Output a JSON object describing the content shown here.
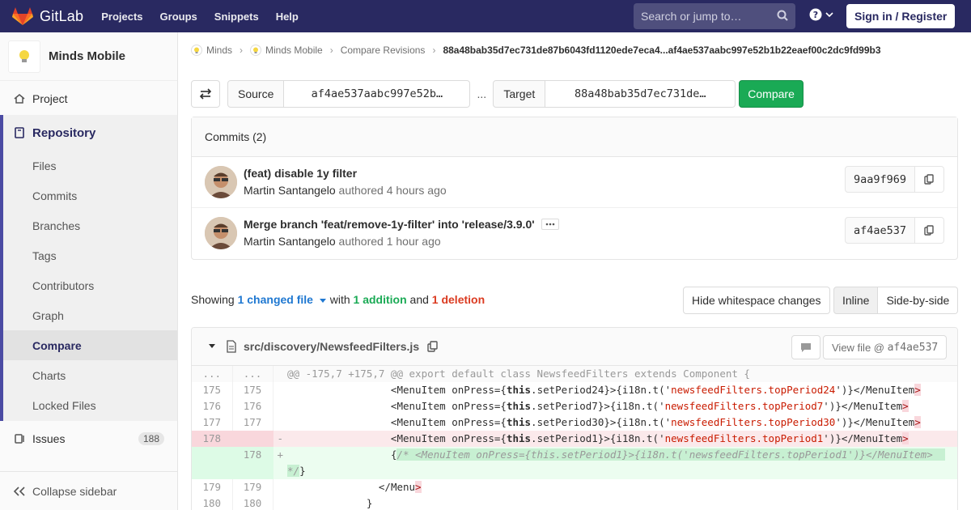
{
  "nav": {
    "brand": "GitLab",
    "links": [
      "Projects",
      "Groups",
      "Snippets",
      "Help"
    ],
    "search_placeholder": "Search or jump to…",
    "signin": "Sign in / Register"
  },
  "sidebar": {
    "project_name": "Minds Mobile",
    "project": "Project",
    "repository": "Repository",
    "repo_items": [
      "Files",
      "Commits",
      "Branches",
      "Tags",
      "Contributors",
      "Graph",
      "Compare",
      "Charts",
      "Locked Files"
    ],
    "issues": "Issues",
    "issues_count": "188",
    "collapse": "Collapse sidebar"
  },
  "breadcrumb": {
    "group": "Minds",
    "project": "Minds Mobile",
    "page": "Compare Revisions",
    "current": "88a48bab35d7ec731de87b6043fd1120ede7eca4...af4ae537aabc997e52b1b22eaef00c2dc9fd99b3"
  },
  "compare": {
    "source_label": "Source",
    "source_value": "af4ae537aabc997e52b…",
    "dots": "...",
    "target_label": "Target",
    "target_value": "88a48bab35d7ec731de…",
    "button": "Compare"
  },
  "commits": {
    "header": "Commits (2)",
    "items": [
      {
        "title": "(feat) disable 1y filter",
        "author": "Martin Santangelo",
        "authored": "authored",
        "time": "4 hours ago",
        "sha": "9aa9f969"
      },
      {
        "title": "Merge branch 'feat/remove-1y-filter' into 'release/3.9.0'",
        "author": "Martin Santangelo",
        "authored": "authored",
        "time": "1 hour ago",
        "sha": "af4ae537"
      }
    ]
  },
  "summary": {
    "showing": "Showing",
    "changed": "1 changed file",
    "with": "with",
    "additions": "1 addition",
    "and": "and",
    "deletions": "1 deletion",
    "hide_ws": "Hide whitespace changes",
    "inline": "Inline",
    "side_by_side": "Side-by-side"
  },
  "file": {
    "path": "src/discovery/NewsfeedFilters.js",
    "view_file": "View file @ ",
    "view_sha": "af4ae537",
    "hunk": "@@ -175,7 +175,7 @@ export default class NewsfeedFilters extends Component {",
    "hunk_ln": "...",
    "lines": [
      {
        "old": "175",
        "new": "175"
      },
      {
        "old": "176",
        "new": "176"
      },
      {
        "old": "177",
        "new": "177"
      },
      {
        "old": "178",
        "new": "",
        "sign": "-"
      },
      {
        "old": "",
        "new": "178",
        "sign": "+"
      },
      {
        "old": "179",
        "new": "179"
      },
      {
        "old": "180",
        "new": "180"
      }
    ]
  },
  "colors": {
    "nav": "#292961",
    "accent": "#1aaa55",
    "link": "#1f78d1",
    "deletion": "#db3b21"
  }
}
